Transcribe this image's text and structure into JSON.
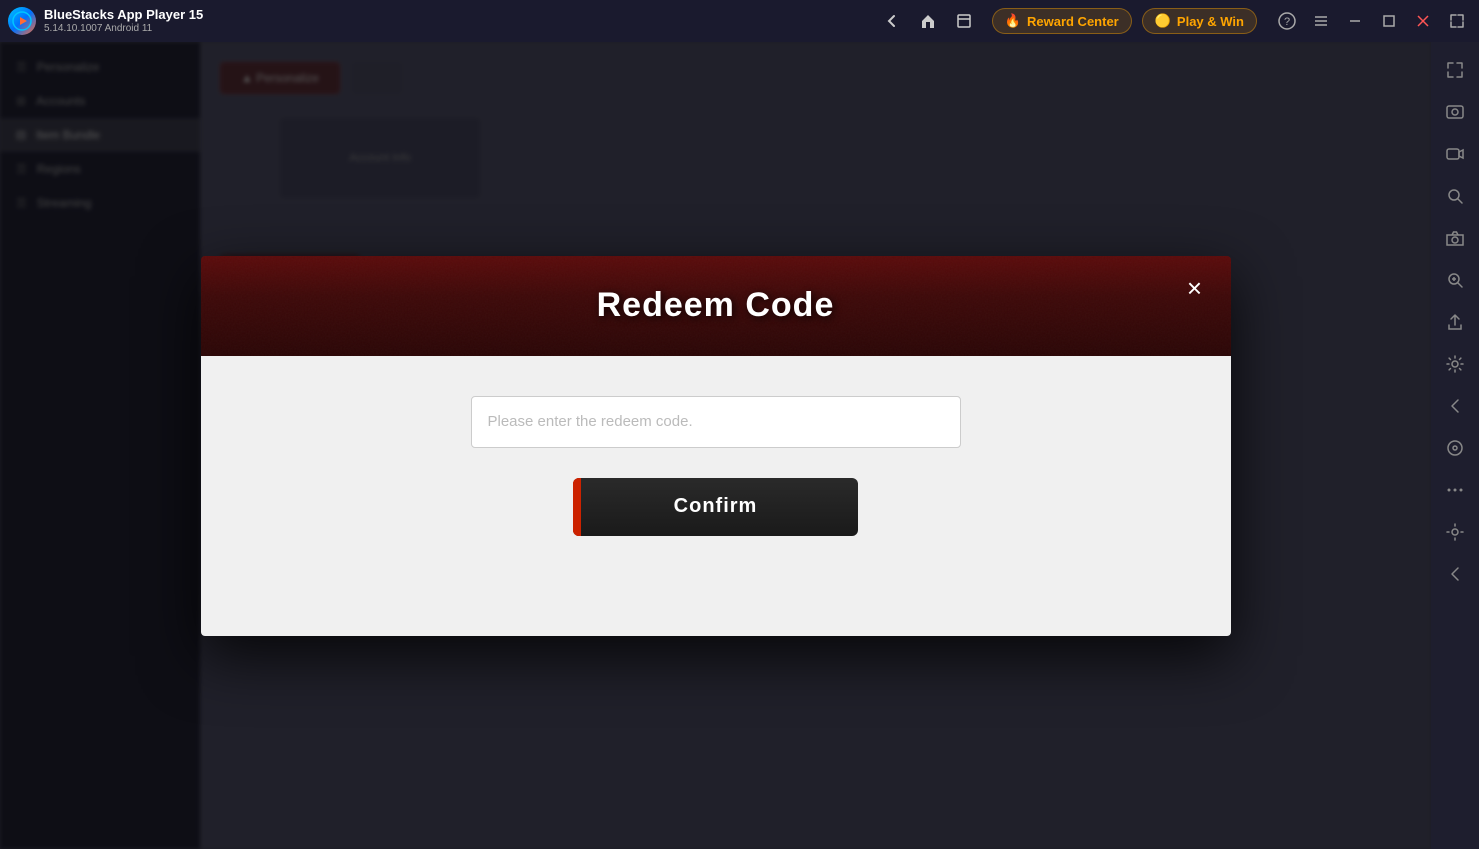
{
  "titleBar": {
    "appName": "BlueStacks App Player 15",
    "version": "5.14.10.1007  Android 11",
    "nav": {
      "back": "←",
      "home": "⌂",
      "layers": "⊟"
    },
    "rewardCenter": "Reward Center",
    "playAndWin": "Play & Win",
    "controls": {
      "help": "?",
      "menu": "≡",
      "minimize": "─",
      "maximize": "□",
      "close": "✕",
      "expand": "⤢"
    }
  },
  "dialog": {
    "title": "Redeem Code",
    "closeBtn": "×",
    "inputPlaceholder": "Please enter the redeem code.",
    "confirmBtn": "Confirm"
  },
  "rightSidebar": {
    "icons": [
      "⚡",
      "📷",
      "⏺",
      "🔍",
      "📹",
      "🔎",
      "📤",
      "⚙",
      "◀",
      "🕹",
      "•••",
      "⚙",
      "◀"
    ]
  }
}
